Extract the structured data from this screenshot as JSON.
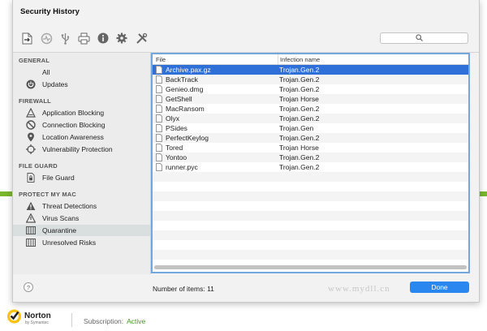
{
  "window": {
    "title": "Security History"
  },
  "toolbar": {
    "icons": [
      "export-icon",
      "activity-icon",
      "usb-icon",
      "print-icon",
      "info-icon",
      "settings-icon",
      "tools-icon"
    ],
    "search_placeholder": ""
  },
  "sidebar": {
    "sections": {
      "general": "GENERAL",
      "firewall": "FIREWALL",
      "file_guard": "FILE GUARD",
      "protect_my_mac": "PROTECT MY MAC"
    },
    "items": [
      {
        "label": "All"
      },
      {
        "label": "Updates"
      },
      {
        "label": "Application Blocking"
      },
      {
        "label": "Connection Blocking"
      },
      {
        "label": "Location Awareness"
      },
      {
        "label": "Vulnerability Protection"
      },
      {
        "label": "File Guard"
      },
      {
        "label": "Threat Detections"
      },
      {
        "label": "Virus Scans"
      },
      {
        "label": "Quarantine"
      },
      {
        "label": "Unresolved Risks"
      }
    ],
    "selected": "Quarantine"
  },
  "table": {
    "columns": [
      "File",
      "Infection name"
    ],
    "rows": [
      {
        "file": "Archive.pax.gz",
        "infection": "Trojan.Gen.2"
      },
      {
        "file": "BackTrack",
        "infection": "Trojan.Gen.2"
      },
      {
        "file": "Genieo.dmg",
        "infection": "Trojan.Gen.2"
      },
      {
        "file": "GetShell",
        "infection": "Trojan Horse"
      },
      {
        "file": "MacRansom",
        "infection": "Trojan.Gen.2"
      },
      {
        "file": "Olyx",
        "infection": "Trojan.Gen.2"
      },
      {
        "file": "PSides",
        "infection": "Trojan.Gen"
      },
      {
        "file": "PerfectKeylog",
        "infection": "Trojan.Gen.2"
      },
      {
        "file": "Tored",
        "infection": "Trojan Horse"
      },
      {
        "file": "Yontoo",
        "infection": "Trojan.Gen.2"
      },
      {
        "file": "runner.pyc",
        "infection": "Trojan.Gen.2"
      }
    ],
    "selected_row": "Archive.pax.gz"
  },
  "footer": {
    "help_label": "?",
    "count_label": "Number of items: 11",
    "watermark": "www.mydll.cn",
    "done_label": "Done"
  },
  "brand": {
    "name": "Norton",
    "sub": "by Symantec",
    "subscription_label": "Subscription:",
    "subscription_status": "Active"
  },
  "colors": {
    "accent": "#2a87f0",
    "selection": "#2e6fd8",
    "brand_green": "#79b72d",
    "status_active": "#3c9a1c",
    "norton_yellow": "#ffc20e"
  }
}
